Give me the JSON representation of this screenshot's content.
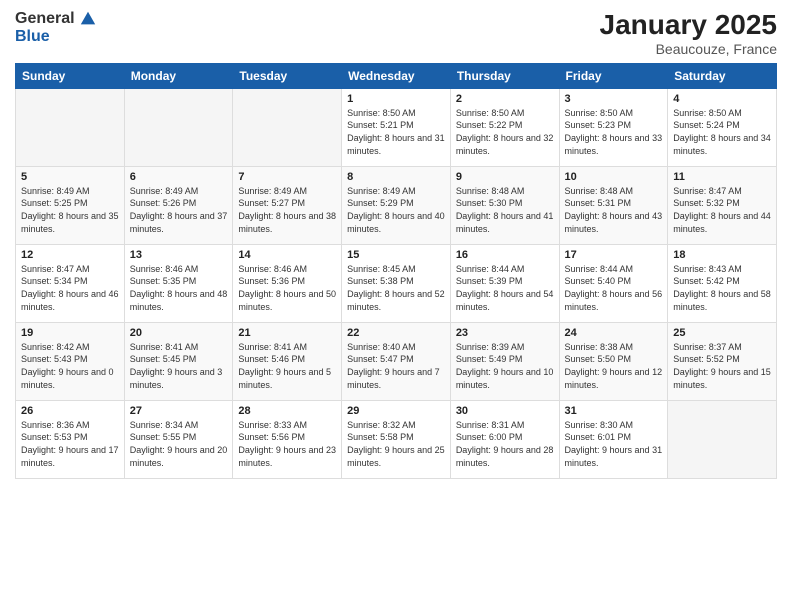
{
  "header": {
    "logo_general": "General",
    "logo_blue": "Blue",
    "month_title": "January 2025",
    "location": "Beaucouze, France"
  },
  "weekdays": [
    "Sunday",
    "Monday",
    "Tuesday",
    "Wednesday",
    "Thursday",
    "Friday",
    "Saturday"
  ],
  "weeks": [
    [
      {
        "day": "",
        "sunrise": "",
        "sunset": "",
        "daylight": ""
      },
      {
        "day": "",
        "sunrise": "",
        "sunset": "",
        "daylight": ""
      },
      {
        "day": "",
        "sunrise": "",
        "sunset": "",
        "daylight": ""
      },
      {
        "day": "1",
        "sunrise": "Sunrise: 8:50 AM",
        "sunset": "Sunset: 5:21 PM",
        "daylight": "Daylight: 8 hours and 31 minutes."
      },
      {
        "day": "2",
        "sunrise": "Sunrise: 8:50 AM",
        "sunset": "Sunset: 5:22 PM",
        "daylight": "Daylight: 8 hours and 32 minutes."
      },
      {
        "day": "3",
        "sunrise": "Sunrise: 8:50 AM",
        "sunset": "Sunset: 5:23 PM",
        "daylight": "Daylight: 8 hours and 33 minutes."
      },
      {
        "day": "4",
        "sunrise": "Sunrise: 8:50 AM",
        "sunset": "Sunset: 5:24 PM",
        "daylight": "Daylight: 8 hours and 34 minutes."
      }
    ],
    [
      {
        "day": "5",
        "sunrise": "Sunrise: 8:49 AM",
        "sunset": "Sunset: 5:25 PM",
        "daylight": "Daylight: 8 hours and 35 minutes."
      },
      {
        "day": "6",
        "sunrise": "Sunrise: 8:49 AM",
        "sunset": "Sunset: 5:26 PM",
        "daylight": "Daylight: 8 hours and 37 minutes."
      },
      {
        "day": "7",
        "sunrise": "Sunrise: 8:49 AM",
        "sunset": "Sunset: 5:27 PM",
        "daylight": "Daylight: 8 hours and 38 minutes."
      },
      {
        "day": "8",
        "sunrise": "Sunrise: 8:49 AM",
        "sunset": "Sunset: 5:29 PM",
        "daylight": "Daylight: 8 hours and 40 minutes."
      },
      {
        "day": "9",
        "sunrise": "Sunrise: 8:48 AM",
        "sunset": "Sunset: 5:30 PM",
        "daylight": "Daylight: 8 hours and 41 minutes."
      },
      {
        "day": "10",
        "sunrise": "Sunrise: 8:48 AM",
        "sunset": "Sunset: 5:31 PM",
        "daylight": "Daylight: 8 hours and 43 minutes."
      },
      {
        "day": "11",
        "sunrise": "Sunrise: 8:47 AM",
        "sunset": "Sunset: 5:32 PM",
        "daylight": "Daylight: 8 hours and 44 minutes."
      }
    ],
    [
      {
        "day": "12",
        "sunrise": "Sunrise: 8:47 AM",
        "sunset": "Sunset: 5:34 PM",
        "daylight": "Daylight: 8 hours and 46 minutes."
      },
      {
        "day": "13",
        "sunrise": "Sunrise: 8:46 AM",
        "sunset": "Sunset: 5:35 PM",
        "daylight": "Daylight: 8 hours and 48 minutes."
      },
      {
        "day": "14",
        "sunrise": "Sunrise: 8:46 AM",
        "sunset": "Sunset: 5:36 PM",
        "daylight": "Daylight: 8 hours and 50 minutes."
      },
      {
        "day": "15",
        "sunrise": "Sunrise: 8:45 AM",
        "sunset": "Sunset: 5:38 PM",
        "daylight": "Daylight: 8 hours and 52 minutes."
      },
      {
        "day": "16",
        "sunrise": "Sunrise: 8:44 AM",
        "sunset": "Sunset: 5:39 PM",
        "daylight": "Daylight: 8 hours and 54 minutes."
      },
      {
        "day": "17",
        "sunrise": "Sunrise: 8:44 AM",
        "sunset": "Sunset: 5:40 PM",
        "daylight": "Daylight: 8 hours and 56 minutes."
      },
      {
        "day": "18",
        "sunrise": "Sunrise: 8:43 AM",
        "sunset": "Sunset: 5:42 PM",
        "daylight": "Daylight: 8 hours and 58 minutes."
      }
    ],
    [
      {
        "day": "19",
        "sunrise": "Sunrise: 8:42 AM",
        "sunset": "Sunset: 5:43 PM",
        "daylight": "Daylight: 9 hours and 0 minutes."
      },
      {
        "day": "20",
        "sunrise": "Sunrise: 8:41 AM",
        "sunset": "Sunset: 5:45 PM",
        "daylight": "Daylight: 9 hours and 3 minutes."
      },
      {
        "day": "21",
        "sunrise": "Sunrise: 8:41 AM",
        "sunset": "Sunset: 5:46 PM",
        "daylight": "Daylight: 9 hours and 5 minutes."
      },
      {
        "day": "22",
        "sunrise": "Sunrise: 8:40 AM",
        "sunset": "Sunset: 5:47 PM",
        "daylight": "Daylight: 9 hours and 7 minutes."
      },
      {
        "day": "23",
        "sunrise": "Sunrise: 8:39 AM",
        "sunset": "Sunset: 5:49 PM",
        "daylight": "Daylight: 9 hours and 10 minutes."
      },
      {
        "day": "24",
        "sunrise": "Sunrise: 8:38 AM",
        "sunset": "Sunset: 5:50 PM",
        "daylight": "Daylight: 9 hours and 12 minutes."
      },
      {
        "day": "25",
        "sunrise": "Sunrise: 8:37 AM",
        "sunset": "Sunset: 5:52 PM",
        "daylight": "Daylight: 9 hours and 15 minutes."
      }
    ],
    [
      {
        "day": "26",
        "sunrise": "Sunrise: 8:36 AM",
        "sunset": "Sunset: 5:53 PM",
        "daylight": "Daylight: 9 hours and 17 minutes."
      },
      {
        "day": "27",
        "sunrise": "Sunrise: 8:34 AM",
        "sunset": "Sunset: 5:55 PM",
        "daylight": "Daylight: 9 hours and 20 minutes."
      },
      {
        "day": "28",
        "sunrise": "Sunrise: 8:33 AM",
        "sunset": "Sunset: 5:56 PM",
        "daylight": "Daylight: 9 hours and 23 minutes."
      },
      {
        "day": "29",
        "sunrise": "Sunrise: 8:32 AM",
        "sunset": "Sunset: 5:58 PM",
        "daylight": "Daylight: 9 hours and 25 minutes."
      },
      {
        "day": "30",
        "sunrise": "Sunrise: 8:31 AM",
        "sunset": "Sunset: 6:00 PM",
        "daylight": "Daylight: 9 hours and 28 minutes."
      },
      {
        "day": "31",
        "sunrise": "Sunrise: 8:30 AM",
        "sunset": "Sunset: 6:01 PM",
        "daylight": "Daylight: 9 hours and 31 minutes."
      },
      {
        "day": "",
        "sunrise": "",
        "sunset": "",
        "daylight": ""
      }
    ]
  ]
}
